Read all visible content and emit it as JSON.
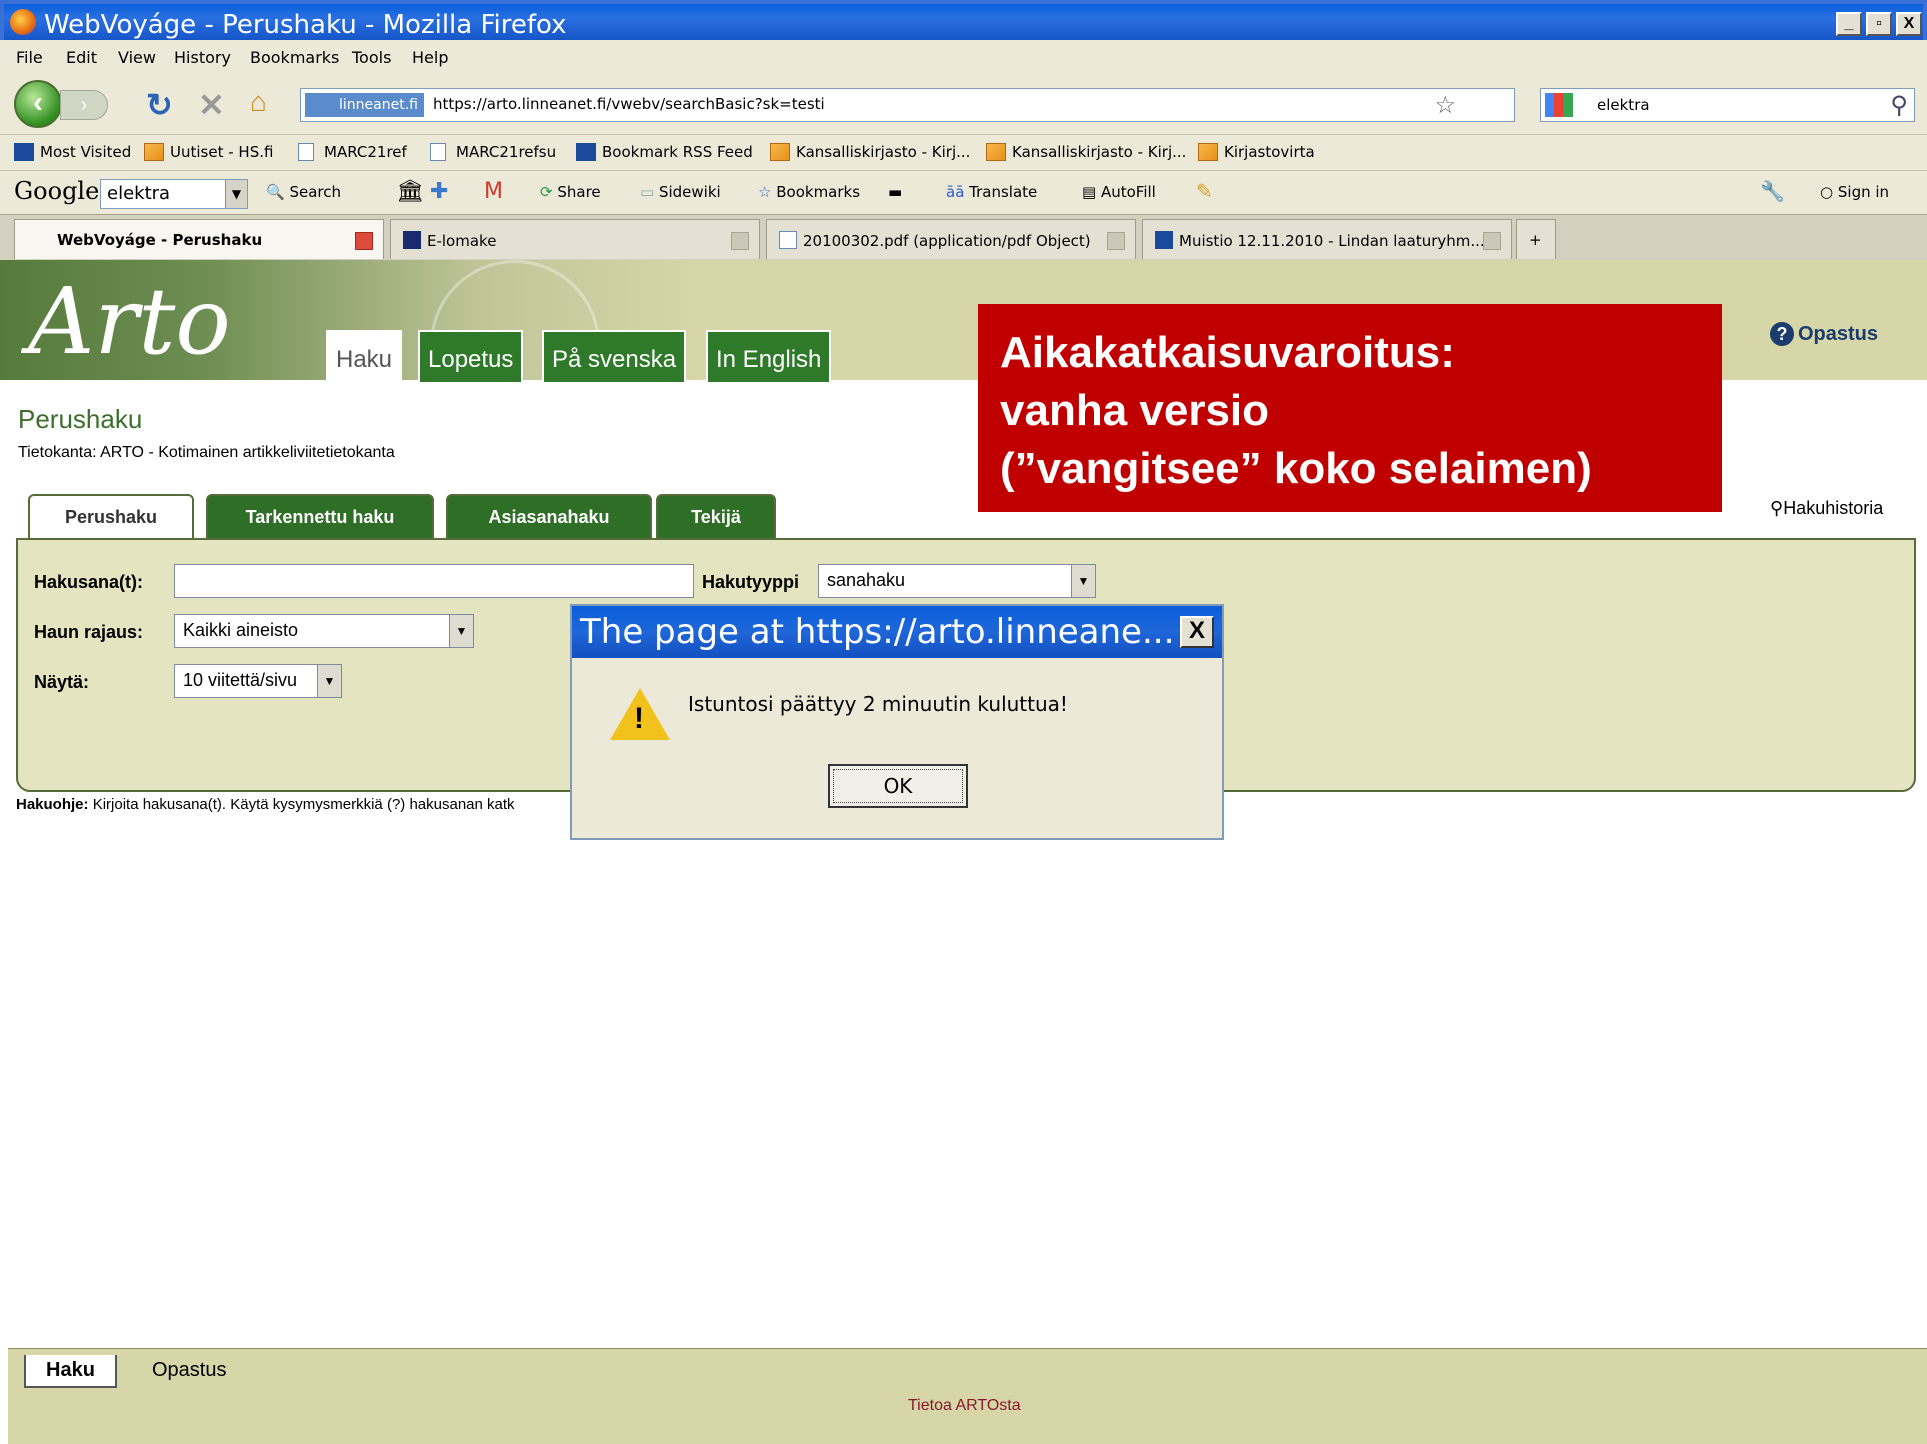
{
  "window": {
    "title": "WebVoyáge - Perushaku - Mozilla Firefox",
    "controls": [
      "_",
      "▫",
      "X"
    ]
  },
  "menu": [
    "File",
    "Edit",
    "View",
    "History",
    "Bookmarks",
    "Tools",
    "Help"
  ],
  "nav": {
    "site_badge": "linneanet.fi",
    "url": "https://arto.linneanet.fi/vwebv/searchBasic?sk=testi",
    "search_value": "elektra"
  },
  "bookmarks": [
    "Most Visited",
    "Uutiset - HS.fi",
    "MARC21ref",
    "MARC21refsu",
    "Bookmark RSS Feed",
    "Kansalliskirjasto - Kirj...",
    "Kansalliskirjasto - Kirj...",
    "Kirjastovirta"
  ],
  "google_toolbar": {
    "logo": "Google",
    "query": "elektra",
    "items": [
      "Search",
      "Share",
      "Sidewiki",
      "Bookmarks",
      "Translate",
      "AutoFill"
    ],
    "sign_in": "Sign in"
  },
  "tabs": [
    "WebVoyáge - Perushaku",
    "E-lomake",
    "20100302.pdf (application/pdf Object)",
    "Muistio 12.11.2010 - Lindan laaturyhm..."
  ],
  "header": {
    "logo": "Arto",
    "tabs": [
      "Haku",
      "Lopetus",
      "På svenska",
      "In English"
    ],
    "help": "Opastus"
  },
  "annotation": [
    "Aikakatkaisuvaroitus:",
    "vanha versio",
    "(”vangitsee” koko selaimen)"
  ],
  "page": {
    "title": "Perushaku",
    "database": "Tietokanta: ARTO - Kotimainen artikkeliviitetietokanta",
    "history_link": "Hakuhistoria",
    "search_tabs": [
      "Perushaku",
      "Tarkennettu haku",
      "Asiasanahaku",
      "Tekijä"
    ]
  },
  "form": {
    "keyword_label": "Hakusana(t):",
    "keyword_value": "",
    "type_label": "Hakutyyppi",
    "type_value": "sanahaku",
    "scope_label": "Haun rajaus:",
    "scope_value": "Kaikki aineisto",
    "show_label": "Näytä:",
    "show_value": "10 viitettä/sivu"
  },
  "hint": {
    "label": "Hakuohje:",
    "text": "Kirjoita hakusana(t). Käytä kysymysmerkkiä (?) hakusanan katk"
  },
  "dialog": {
    "title": "The page at https://arto.linneane...",
    "close": "X",
    "message": "Istuntosi päättyy 2 minuutin kuluttua!",
    "ok": "OK"
  },
  "footer": {
    "tabs": [
      "Haku",
      "Opastus"
    ],
    "about": "Tietoa ARTOsta"
  }
}
